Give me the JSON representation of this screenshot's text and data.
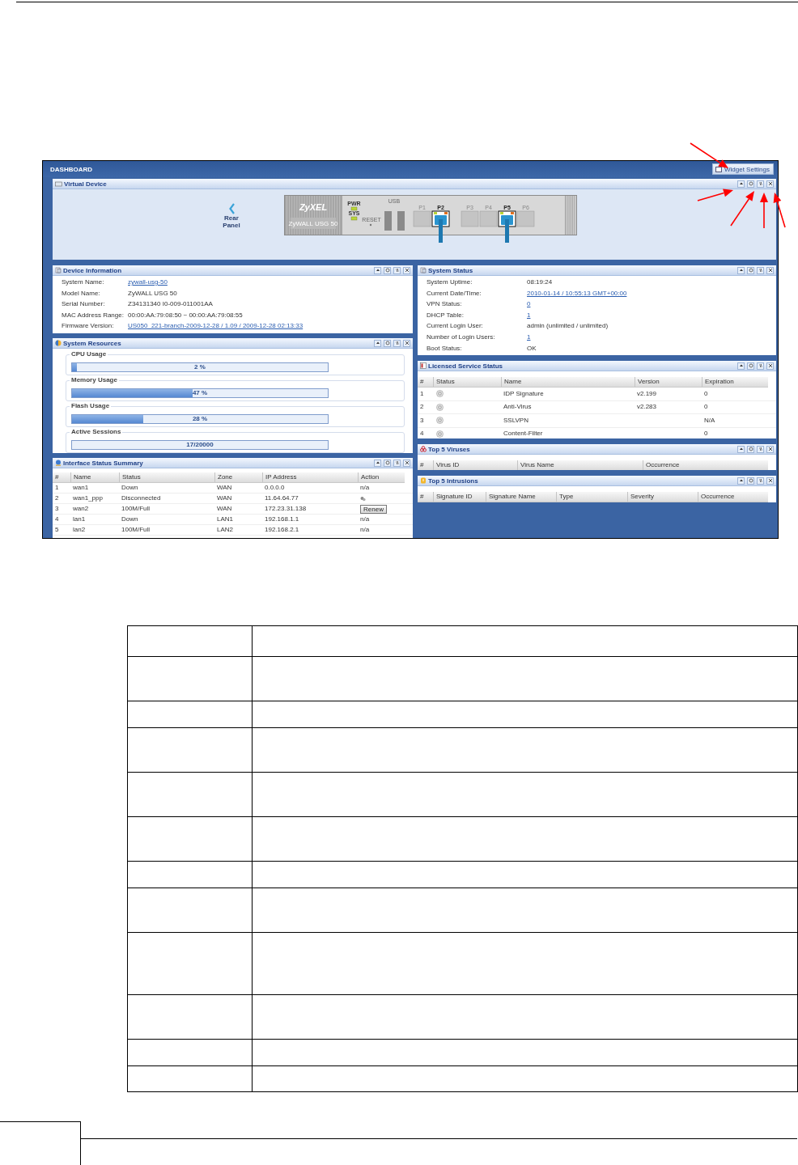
{
  "dashboard": {
    "title": "DASHBOARD",
    "widget_settings": "Widget Settings"
  },
  "virtual_device": {
    "title": "Virtual Device",
    "rear_panel": "Rear Panel",
    "logo": "ZyXEL",
    "model": "ZyWALL USG 50",
    "leds": [
      "PWR",
      "SYS"
    ],
    "reset": "RESET",
    "usb": "USB",
    "ports": [
      {
        "label": "P1",
        "connected": false
      },
      {
        "label": "P2",
        "connected": true
      },
      {
        "label": "P3",
        "connected": false
      },
      {
        "label": "P4",
        "connected": false
      },
      {
        "label": "P5",
        "connected": true
      },
      {
        "label": "P6",
        "connected": false
      }
    ]
  },
  "device_information": {
    "title": "Device Information",
    "fields": [
      {
        "label": "System Name:",
        "value": "zywall-usg-50",
        "link": true
      },
      {
        "label": "Model Name:",
        "value": "ZyWALL USG 50",
        "link": false
      },
      {
        "label": "Serial Number:",
        "value": "Z34131340 I0-009-011001AA",
        "link": false
      },
      {
        "label": "MAC Address Range:",
        "value": "00:00:AA:79:08:50 ~ 00:00:AA:79:08:55",
        "link": false
      },
      {
        "label": "Firmware Version:",
        "value": "US050_221-branch-2009-12-28 / 1.09 / 2009-12-28 02:13:33",
        "link": true
      }
    ]
  },
  "system_resources": {
    "title": "System Resources",
    "meters": [
      {
        "label": "CPU Usage",
        "level": 0.02,
        "reading": "2 %"
      },
      {
        "label": "Memory Usage",
        "level": 0.47,
        "reading": "47 %"
      },
      {
        "label": "Flash Usage",
        "level": 0.28,
        "reading": "28 %"
      },
      {
        "label": "Active Sessions",
        "level": 0.001,
        "reading": "17/20000"
      }
    ]
  },
  "interface_status_summary": {
    "title": "Interface Status Summary",
    "columns": [
      "#",
      "Name",
      "Status",
      "Zone",
      "IP Address",
      "Action"
    ],
    "rows": [
      {
        "index": "1",
        "name": "wan1",
        "status": "Down",
        "zone": "WAN",
        "ip": "0.0.0.0",
        "action": {
          "kind": "text",
          "label": "n/a"
        }
      },
      {
        "index": "2",
        "name": "wan1_ppp",
        "status": "Disconnected",
        "zone": "WAN",
        "ip": "11.64.64.77",
        "action": {
          "kind": "icon"
        }
      },
      {
        "index": "3",
        "name": "wan2",
        "status": "100M/Full",
        "zone": "WAN",
        "ip": "172.23.31.138",
        "action": {
          "kind": "button",
          "label": "Renew"
        }
      },
      {
        "index": "4",
        "name": "lan1",
        "status": "Down",
        "zone": "LAN1",
        "ip": "192.168.1.1",
        "action": {
          "kind": "text",
          "label": "n/a"
        }
      },
      {
        "index": "5",
        "name": "lan2",
        "status": "100M/Full",
        "zone": "LAN2",
        "ip": "192.168.2.1",
        "action": {
          "kind": "text",
          "label": "n/a"
        }
      }
    ]
  },
  "system_status": {
    "title": "System Status",
    "fields": [
      {
        "label": "System Uptime:",
        "value": "08:19:24",
        "link": false
      },
      {
        "label": "Current Date/Time:",
        "value": "2010-01-14 / 10:55:13 GMT+00:00",
        "link": true
      },
      {
        "label": "VPN Status:",
        "value": "0",
        "link": true
      },
      {
        "label": "DHCP Table:",
        "value": "1",
        "link": true
      },
      {
        "label": "Current Login User:",
        "value": "admin (unlimited / unlimited)",
        "link": false
      },
      {
        "label": "Number of Login Users:",
        "value": "1",
        "link": true
      },
      {
        "label": "Boot Status:",
        "value": "OK",
        "link": false
      }
    ]
  },
  "licensed_service_status": {
    "title": "Licensed Service Status",
    "columns": [
      "#",
      "Status",
      "Name",
      "Version",
      "Expiration"
    ],
    "rows": [
      {
        "index": "1",
        "name": "IDP Signature",
        "version": "v2.199",
        "expiration": "0"
      },
      {
        "index": "2",
        "name": "Anti-Virus",
        "version": "v2.283",
        "expiration": "0"
      },
      {
        "index": "3",
        "name": "SSLVPN",
        "expiration": "N/A"
      },
      {
        "index": "4",
        "name": "Content-Filter",
        "expiration": "0"
      }
    ]
  },
  "top_5_viruses": {
    "title": "Top 5 Viruses",
    "columns": [
      "#",
      "Virus ID",
      "Virus Name",
      "Occurrence"
    ]
  },
  "top_5_intrusions": {
    "title": "Top 5 Intrusions",
    "columns": [
      "#",
      "Signature ID",
      "Signature Name",
      "Type",
      "Severity",
      "Occurrence"
    ]
  }
}
